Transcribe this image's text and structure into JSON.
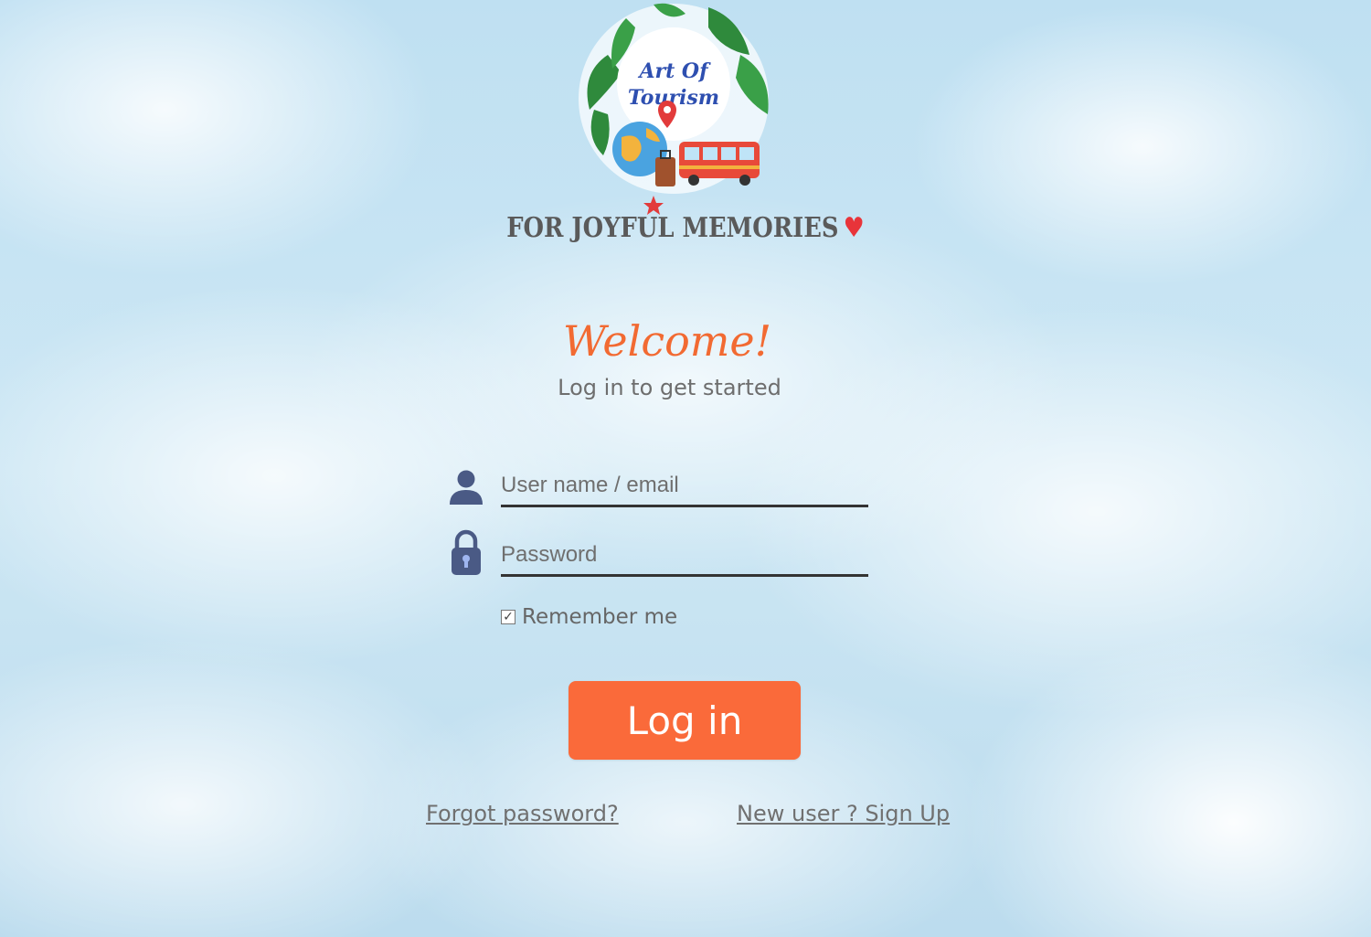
{
  "brand": {
    "logo_text_line1": "Art Of",
    "logo_text_line2": "Tourism",
    "tagline": "FOR JOYFUL MEMORIES",
    "tagline_heart": "♥"
  },
  "header": {
    "welcome": "Welcome!",
    "subtitle": "Log in to get started"
  },
  "form": {
    "username_placeholder": "User name / email",
    "username_value": "",
    "password_placeholder": "Password",
    "password_value": "",
    "remember_label": "Remember me",
    "remember_checked": true,
    "login_label": "Log in"
  },
  "links": {
    "forgot": "Forgot password?",
    "signup": "New user ? Sign Up"
  },
  "colors": {
    "accent": "#fa6a3a",
    "welcome": "#f26a32",
    "icon": "#4a5a85"
  },
  "icons": {
    "username": "user-icon",
    "password": "lock-icon",
    "checkbox": "check-icon"
  }
}
